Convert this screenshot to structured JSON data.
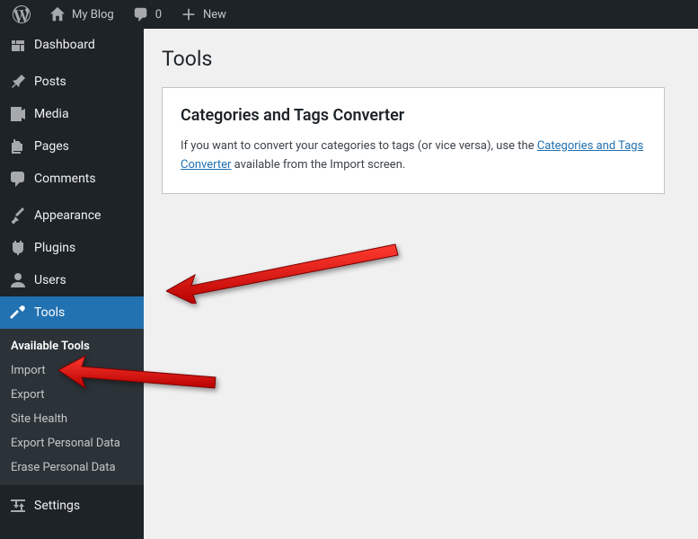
{
  "adminbar": {
    "site_name": "My Blog",
    "comments_count": "0",
    "new_label": "New"
  },
  "sidebar": {
    "items": [
      {
        "label": "Dashboard",
        "icon": "dashboard"
      },
      {
        "label": "Posts",
        "icon": "pin"
      },
      {
        "label": "Media",
        "icon": "media"
      },
      {
        "label": "Pages",
        "icon": "pages"
      },
      {
        "label": "Comments",
        "icon": "comments"
      },
      {
        "label": "Appearance",
        "icon": "appearance"
      },
      {
        "label": "Plugins",
        "icon": "plugin"
      },
      {
        "label": "Users",
        "icon": "users"
      },
      {
        "label": "Tools",
        "icon": "tools"
      },
      {
        "label": "Settings",
        "icon": "settings"
      }
    ]
  },
  "submenu": {
    "items": [
      "Available Tools",
      "Import",
      "Export",
      "Site Health",
      "Export Personal Data",
      "Erase Personal Data"
    ]
  },
  "page": {
    "title": "Tools",
    "card_heading": "Categories and Tags Converter",
    "card_text_before": "If you want to convert your categories to tags (or vice versa), use the ",
    "card_link": "Categories and Tags Converter",
    "card_text_after": " available from the Import screen."
  }
}
